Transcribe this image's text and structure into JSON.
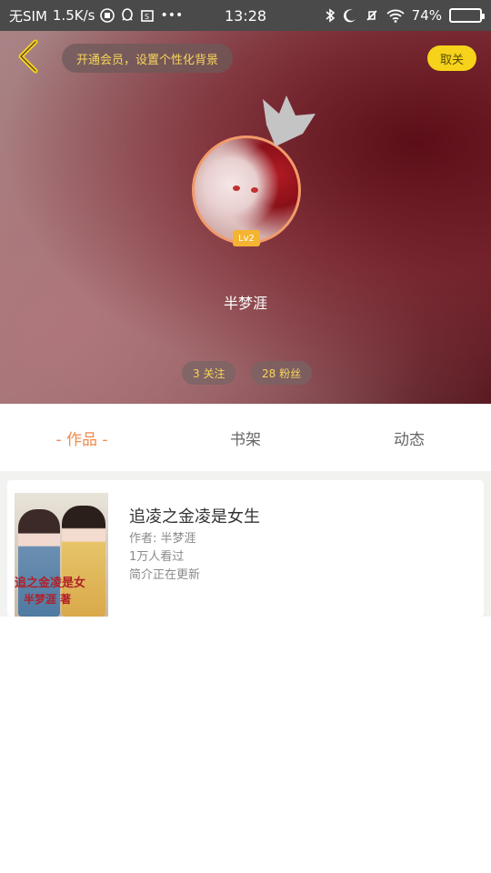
{
  "status_bar": {
    "carrier": "无SIM",
    "speed": "1.5K/s",
    "time": "13:28",
    "battery_percent": "74%",
    "battery_level": 0.74,
    "icons": [
      "carrier-signal-icon",
      "speed-icon",
      "app-notification-icon",
      "qq-icon",
      "screenshot-icon",
      "more-dots-icon",
      "bluetooth-icon",
      "moon-icon",
      "vibrate-off-icon",
      "wifi-icon",
      "battery-icon"
    ]
  },
  "header": {
    "vip_banner": "开通会员，设置个性化背景",
    "unfollow_label": "取关",
    "back_icon": "chevron-left-icon",
    "accent_yellow": "#f6d21a"
  },
  "profile": {
    "level": "Lv2",
    "username": "半梦涯",
    "follow_stat": "3 关注",
    "fans_stat": "28 粉丝"
  },
  "tabs": [
    {
      "label": "- 作品 -",
      "active": true
    },
    {
      "label": "书架",
      "active": false
    },
    {
      "label": "动态",
      "active": false
    }
  ],
  "tab_active_color": "#ef8a4d",
  "books": [
    {
      "title": "追凌之金凌是女生",
      "author": "作者: 半梦涯",
      "views": "1万人看过",
      "summary": "简介正在更新",
      "cover_title_text": "追之金凌是女",
      "cover_author_text": "半梦涯  著"
    }
  ]
}
